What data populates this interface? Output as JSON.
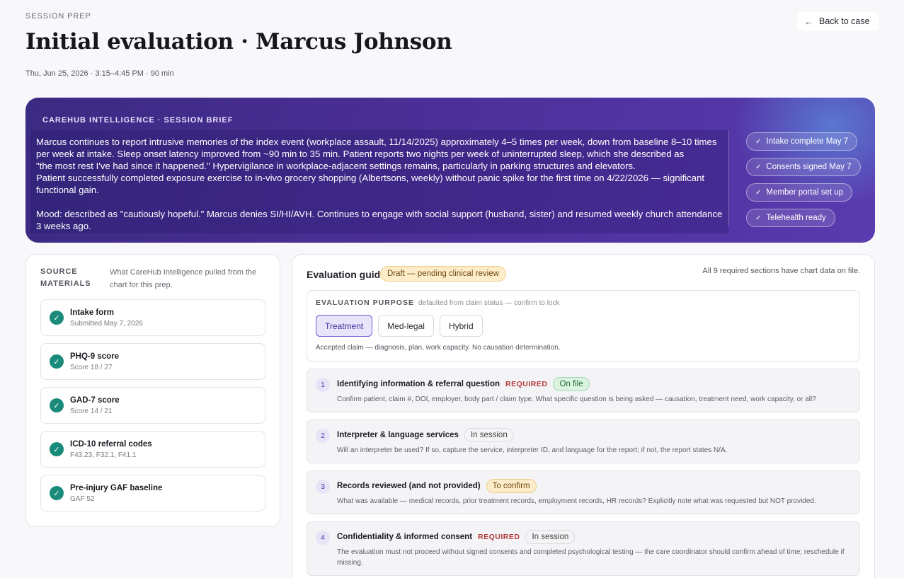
{
  "header": {
    "eyebrow": "SESSION PREP",
    "title": "Initial evaluation · Marcus Johnson",
    "meta": "Thu, Jun 25, 2026 · 3:15–4:45 PM · 90 min",
    "back_label": "Back to case"
  },
  "brief": {
    "label": "CAREHUB INTELLIGENCE · SESSION BRIEF",
    "para1": "Marcus continues to report intrusive memories of the index event (workplace assault, 11/14/2025) approximately 4–5 times per week, down from baseline 8–10 times per week at intake. Sleep onset latency improved from ~90 min to 35 min. Patient reports two nights per week of uninterrupted sleep, which she described as\n\"the most rest I've had since it happened.\" Hypervigilance in workplace-adjacent settings remains, particularly in parking structures and elevators.",
    "para2": " Patient successfully completed exposure exercise to in-vivo grocery shopping (Albertsons, weekly) without panic spike for the first time on 4/22/2026 — significant\n functional gain.",
    "para3": "Mood: described as \"cautiously hopeful.\" Marcus denies SI/HI/AVH. Continues to engage with social support (husband, sister) and resumed weekly church attendance 3 weeks ago.",
    "chips": [
      "Intake complete May 7",
      "Consents signed May 7",
      "Member portal set up",
      "Telehealth ready"
    ]
  },
  "sources": {
    "title": "SOURCE MATERIALS",
    "description": "What CareHub Intelligence pulled from the chart for this prep.",
    "items": [
      {
        "name": "Intake form",
        "sub": "Submitted May 7, 2026"
      },
      {
        "name": "PHQ-9 score",
        "sub": "Score 18 / 27"
      },
      {
        "name": "GAD-7 score",
        "sub": "Score 14 / 21"
      },
      {
        "name": "ICD-10 referral codes",
        "sub": "F43.23, F32.1, F41.1"
      },
      {
        "name": "Pre-injury GAF baseline",
        "sub": "GAF 52"
      }
    ]
  },
  "guide": {
    "title": "Evaluation guide",
    "badge": "Draft — pending clinical review",
    "note": "All 9 required sections have chart data on file.",
    "purpose": {
      "label": "EVALUATION PURPOSE",
      "hint": "defaulted from claim status — confirm to lock",
      "options": [
        "Treatment",
        "Med-legal",
        "Hybrid"
      ],
      "selected": "Treatment",
      "description": "Accepted claim — diagnosis, plan, work capacity. No causation determination."
    },
    "sections": [
      {
        "num": "1",
        "title": "Identifying information & referral question",
        "required": "REQUIRED",
        "status": "On file",
        "desc": "Confirm patient, claim #, DOI, employer, body part / claim type. What specific question is being asked — causation, treatment need, work capacity, or all?"
      },
      {
        "num": "2",
        "title": "Interpreter & language services",
        "required": "",
        "status": "In session",
        "desc": "Will an interpreter be used? If so, capture the service, interpreter ID, and language for the report; if not, the report states N/A."
      },
      {
        "num": "3",
        "title": "Records reviewed (and not provided)",
        "required": "",
        "status": "To confirm",
        "desc": "What was available — medical records, prior treatment records, employment records, HR records? Explicitly note what was requested but NOT provided."
      },
      {
        "num": "4",
        "title": "Confidentiality & informed consent",
        "required": "REQUIRED",
        "status": "In session",
        "desc": "The evaluation must not proceed without signed consents and completed psychological testing — the care coordinator should confirm ahead of time; reschedule if missing."
      }
    ]
  }
}
